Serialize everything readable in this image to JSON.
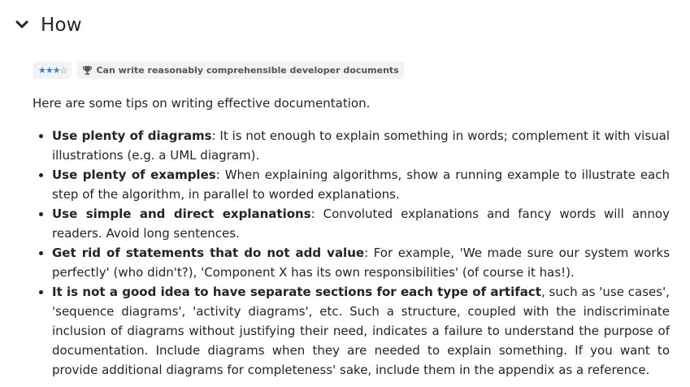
{
  "section": {
    "title": "How",
    "toggle_icon": "chevron-down-icon"
  },
  "rating": {
    "filled": "★★★",
    "empty": "☆",
    "level": 3,
    "max": 4,
    "color": "#3f7ecf"
  },
  "skill": {
    "icon": "trophy-icon",
    "label": "Can write reasonably comprehensible developer documents"
  },
  "intro": "Here are some tips on writing effective documentation.",
  "tips": [
    {
      "bold": "Use plenty of diagrams",
      "text": ": It is not enough to explain something in words; complement it with visual illustrations (e.g. a UML diagram)."
    },
    {
      "bold": "Use plenty of examples",
      "text": ": When explaining algorithms, show a running example to illustrate each step of the algorithm, in parallel to worded explanations."
    },
    {
      "bold": "Use simple and direct explanations",
      "text": ": Convoluted explanations and fancy words will annoy readers. Avoid long sentences."
    },
    {
      "bold": "Get rid of statements that do not add value",
      "text": ": For example, 'We made sure our system works perfectly' (who didn't?), 'Component X has its own responsibilities' (of course it has!)."
    },
    {
      "bold": "It is not a good idea to have separate sections for each type of artifact",
      "text": ", such as 'use cases', 'sequence diagrams', 'activity diagrams', etc. Such a structure, coupled with the indiscriminate inclusion of diagrams without justifying their need, indicates a failure to understand the purpose of documentation. Include diagrams when they are needed to explain something. If you want to provide additional diagrams for completeness' sake, include them in the appendix as a reference."
    }
  ]
}
